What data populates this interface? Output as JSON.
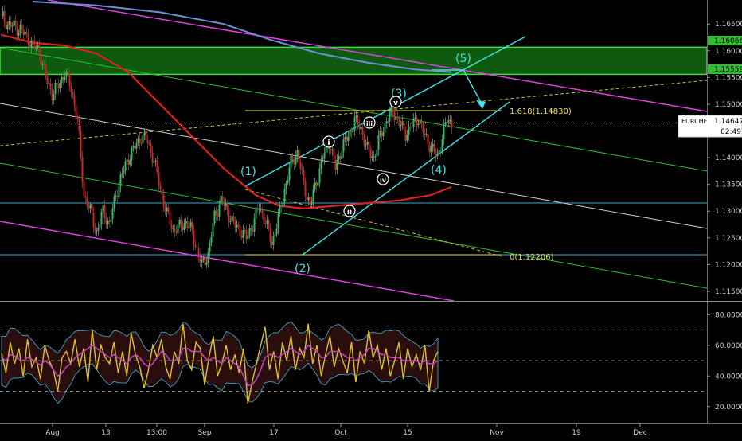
{
  "chart_data": [
    {
      "type": "candlestick",
      "symbol": "EURCHF",
      "price_axis": {
        "ticks": [
          "1.16500",
          "1.16000",
          "1.15500",
          "1.15000",
          "1.14500",
          "1.14000",
          "1.13500",
          "1.13000",
          "1.12500",
          "1.12000",
          "1.11500"
        ],
        "range": [
          1.1135,
          1.1695
        ],
        "labels": [
          {
            "text": "1.16066",
            "value": 1.16066,
            "color": "#2fbf2f"
          },
          {
            "text": "1.15559",
            "value": 1.15559,
            "color": "#2fbf2f"
          },
          {
            "text": "1.14647",
            "value": 1.14647,
            "color": "#ffffff"
          }
        ],
        "countdown": "02:49"
      },
      "time_axis": [
        "Aug",
        "13",
        "13:00",
        "Sep",
        "17",
        "Oct",
        "15",
        "Nov",
        "19",
        "Dec"
      ],
      "price_path": [
        [
          0,
          1.1665
        ],
        [
          4,
          1.165
        ],
        [
          8,
          1.1645
        ],
        [
          12,
          1.164
        ],
        [
          16,
          1.1625
        ],
        [
          20,
          1.161
        ],
        [
          24,
          1.16
        ],
        [
          28,
          1.155
        ],
        [
          32,
          1.152
        ],
        [
          36,
          1.1535
        ],
        [
          40,
          1.156
        ],
        [
          44,
          1.153
        ],
        [
          48,
          1.147
        ],
        [
          52,
          1.133
        ],
        [
          56,
          1.13
        ],
        [
          60,
          1.126
        ],
        [
          64,
          1.13
        ],
        [
          68,
          1.1275
        ],
        [
          72,
          1.133
        ],
        [
          76,
          1.137
        ],
        [
          80,
          1.14
        ],
        [
          84,
          1.142
        ],
        [
          88,
          1.144
        ],
        [
          92,
          1.143
        ],
        [
          96,
          1.1395
        ],
        [
          100,
          1.134
        ],
        [
          104,
          1.1295
        ],
        [
          108,
          1.1265
        ],
        [
          112,
          1.127
        ],
        [
          116,
          1.128
        ],
        [
          120,
          1.126
        ],
        [
          124,
          1.1215
        ],
        [
          126,
          1.1198
        ],
        [
          130,
          1.122
        ],
        [
          134,
          1.129
        ],
        [
          138,
          1.132
        ],
        [
          142,
          1.13
        ],
        [
          146,
          1.1275
        ],
        [
          150,
          1.1265
        ],
        [
          154,
          1.125
        ],
        [
          158,
          1.1275
        ],
        [
          162,
          1.131
        ],
        [
          166,
          1.128
        ],
        [
          170,
          1.124
        ],
        [
          174,
          1.1285
        ],
        [
          178,
          1.134
        ],
        [
          182,
          1.139
        ],
        [
          186,
          1.141
        ],
        [
          190,
          1.135
        ],
        [
          194,
          1.131
        ],
        [
          198,
          1.1355
        ],
        [
          202,
          1.14
        ],
        [
          206,
          1.143
        ],
        [
          210,
          1.138
        ],
        [
          214,
          1.142
        ],
        [
          218,
          1.144
        ],
        [
          222,
          1.147
        ],
        [
          226,
          1.1455
        ],
        [
          230,
          1.1415
        ],
        [
          234,
          1.14
        ],
        [
          238,
          1.144
        ],
        [
          242,
          1.147
        ],
        [
          246,
          1.1488
        ],
        [
          250,
          1.1465
        ],
        [
          254,
          1.1445
        ],
        [
          258,
          1.146
        ],
        [
          262,
          1.1475
        ],
        [
          266,
          1.144
        ],
        [
          270,
          1.142
        ],
        [
          274,
          1.14
        ],
        [
          277,
          1.144
        ],
        [
          280,
          1.147
        ],
        [
          283,
          1.1465
        ]
      ],
      "indicators": {
        "ma_red": [
          [
            0,
            1.163
          ],
          [
            20,
            1.1615
          ],
          [
            40,
            1.161
          ],
          [
            60,
            1.1595
          ],
          [
            80,
            1.156
          ],
          [
            100,
            1.15
          ],
          [
            120,
            1.144
          ],
          [
            140,
            1.138
          ],
          [
            160,
            1.133
          ],
          [
            175,
            1.131
          ],
          [
            190,
            1.1305
          ],
          [
            210,
            1.131
          ],
          [
            230,
            1.1315
          ],
          [
            250,
            1.132
          ],
          [
            270,
            1.133
          ],
          [
            283,
            1.1345
          ]
        ],
        "ma_blue": [
          [
            20,
            1.1692
          ],
          [
            60,
            1.1685
          ],
          [
            100,
            1.1672
          ],
          [
            140,
            1.165
          ],
          [
            170,
            1.162
          ],
          [
            200,
            1.1595
          ],
          [
            230,
            1.1578
          ],
          [
            260,
            1.1565
          ],
          [
            283,
            1.156
          ]
        ]
      },
      "annotations": [
        {
          "text": "1.618(1.14830)",
          "value": 1.1483,
          "color": "#e8e04a"
        },
        {
          "text": "0(1.12206)",
          "value": 1.12206,
          "color": "#e8e04a"
        }
      ],
      "waves": [
        "(1)",
        "(2)",
        "(3)",
        "(4)",
        "(5)",
        "i",
        "ii",
        "iii",
        "iv",
        "v"
      ]
    },
    {
      "type": "line",
      "title": "",
      "y_ticks": [
        "80.0000",
        "60.0000",
        "40.0000",
        "20.0000"
      ],
      "ylim": [
        10,
        88
      ],
      "levels": [
        70,
        50,
        30
      ],
      "series": [
        {
          "color": "#e0c02a",
          "values": [
            55,
            42,
            62,
            48,
            58,
            40,
            64,
            46,
            52,
            38,
            60,
            50,
            44,
            30,
            52,
            56,
            48,
            64,
            46,
            58,
            36,
            70,
            44,
            60,
            52,
            48,
            62,
            42,
            56,
            40,
            68,
            54,
            46,
            32,
            44,
            60,
            52,
            64,
            46,
            38,
            56,
            48,
            74,
            50,
            44,
            62,
            58,
            34,
            52,
            66,
            40,
            48,
            60,
            44,
            54,
            42,
            58,
            22,
            36,
            48,
            60,
            72,
            44,
            56,
            38,
            62,
            50,
            66,
            44,
            58,
            52,
            74,
            48,
            60,
            40,
            54,
            66,
            46,
            58,
            50,
            42,
            62,
            36,
            56,
            48,
            70,
            52,
            60,
            44,
            58,
            40,
            50,
            62,
            38,
            58,
            46,
            54,
            44,
            60,
            30,
            50,
            56
          ]
        },
        {
          "color": "#c040c0",
          "values": [
            52,
            50,
            54,
            53,
            51,
            50,
            52,
            51,
            49,
            47,
            50,
            48,
            44,
            40,
            42,
            46,
            48,
            52,
            54,
            56,
            58,
            60,
            58,
            56,
            54,
            52,
            54,
            52,
            50,
            48,
            52,
            54,
            52,
            48,
            46,
            48,
            52,
            56,
            54,
            50,
            50,
            52,
            58,
            58,
            56,
            56,
            56,
            52,
            50,
            52,
            50,
            48,
            52,
            50,
            48,
            46,
            40,
            34,
            34,
            38,
            44,
            52,
            54,
            54,
            52,
            54,
            56,
            58,
            56,
            54,
            56,
            60,
            58,
            56,
            52,
            52,
            56,
            56,
            56,
            54,
            52,
            52,
            50,
            52,
            54,
            58,
            58,
            56,
            54,
            54,
            52,
            52,
            52,
            50,
            50,
            50,
            50,
            48,
            50,
            48,
            48,
            50
          ]
        }
      ]
    }
  ]
}
